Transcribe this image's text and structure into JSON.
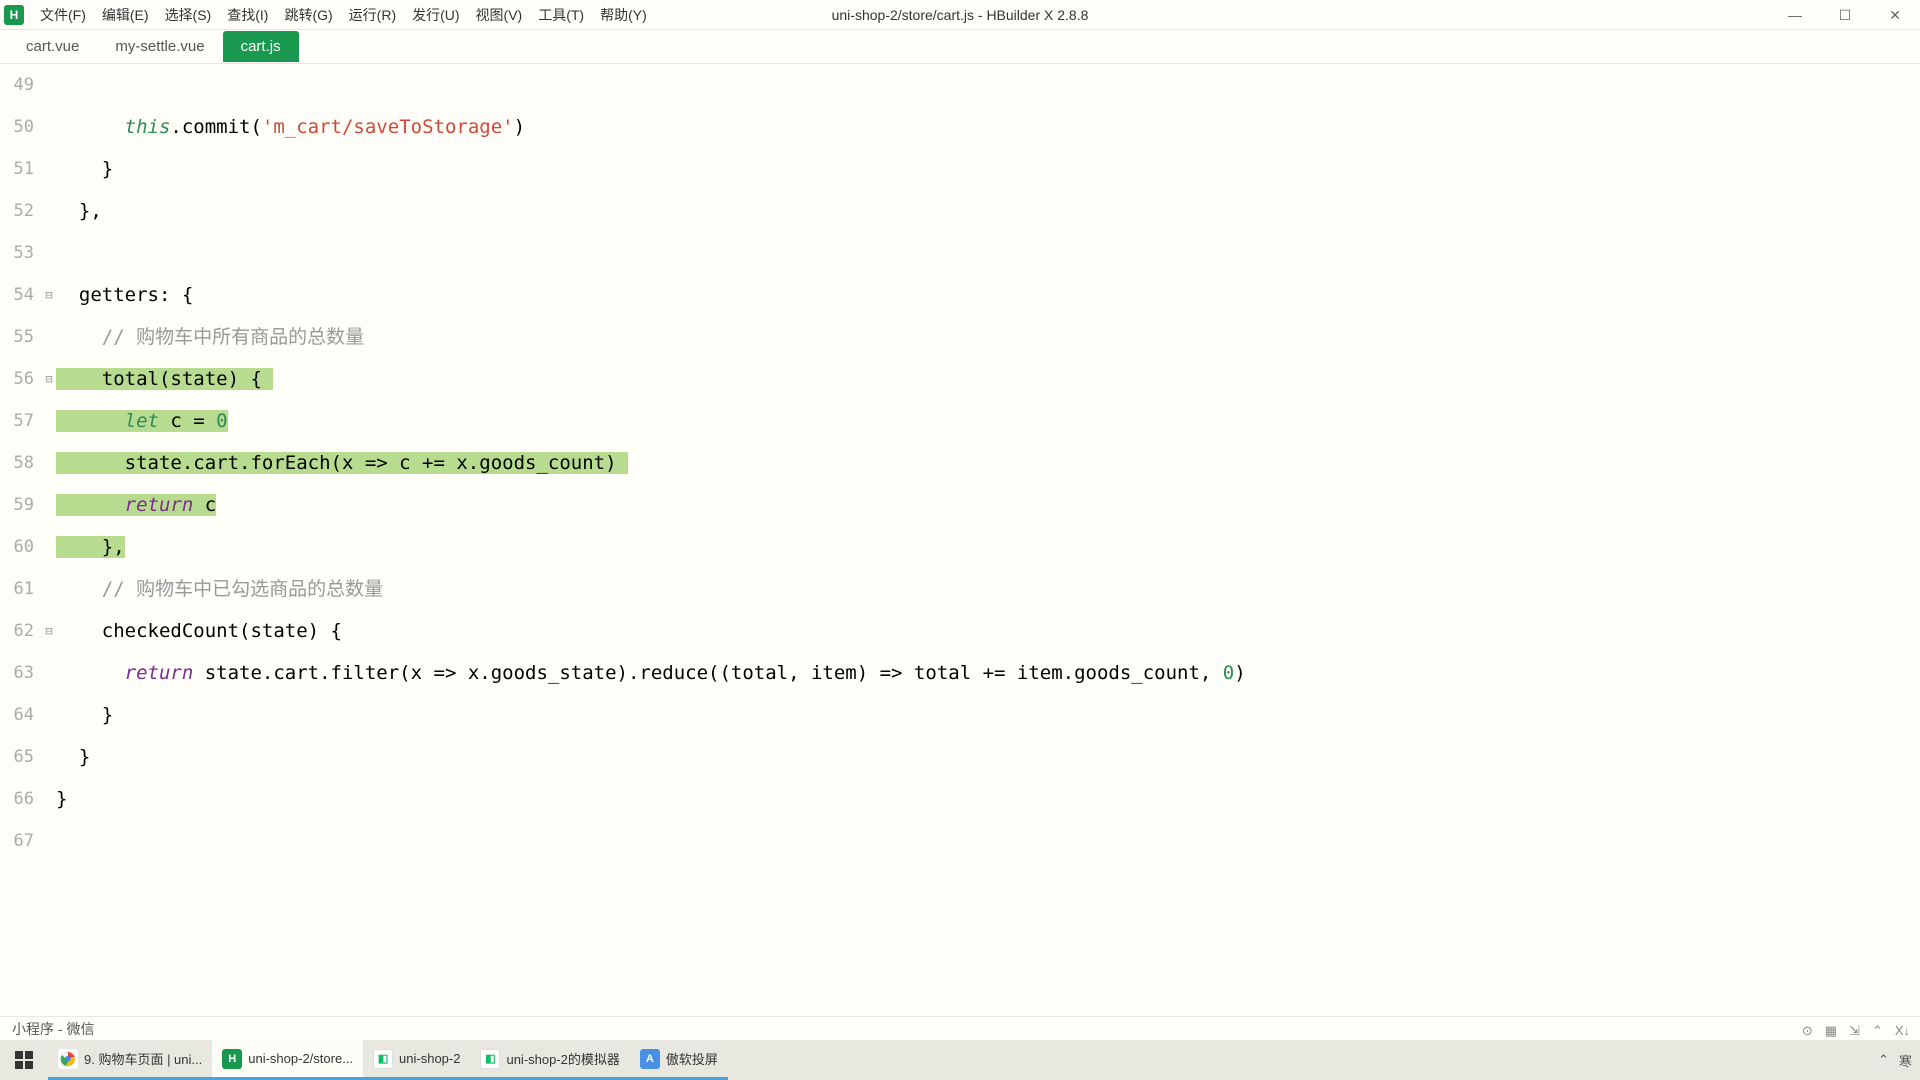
{
  "app": {
    "icon_letter": "H",
    "title": "uni-shop-2/store/cart.js - HBuilder X 2.8.8"
  },
  "menus": {
    "file": "文件(F)",
    "edit": "编辑(E)",
    "select": "选择(S)",
    "find": "查找(I)",
    "goto": "跳转(G)",
    "run": "运行(R)",
    "publish": "发行(U)",
    "view": "视图(V)",
    "tools": "工具(T)",
    "help": "帮助(Y)"
  },
  "win_ctrl": {
    "min": "—",
    "max": "☐",
    "close": "✕"
  },
  "tabs": {
    "t1": "cart.vue",
    "t2": "my-settle.vue",
    "t3": "cart.js"
  },
  "gutter": {
    "l49": "49",
    "l50": "50",
    "l51": "51",
    "l52": "52",
    "l53": "53",
    "l54": "54",
    "l55": "55",
    "l56": "56",
    "l57": "57",
    "l58": "58",
    "l59": "59",
    "l60": "60",
    "l61": "61",
    "l62": "62",
    "l63": "63",
    "l64": "64",
    "l65": "65",
    "l66": "66",
    "l67": "67"
  },
  "fold": {
    "f54": "⊟",
    "f56": "⊟",
    "f62": "⊟"
  },
  "code": {
    "l50_this": "this",
    "l50_rest": ".commit(",
    "l50_str": "'m_cart/saveToStorage'",
    "l50_end": ")",
    "l51": "}",
    "l52": "},",
    "l54_a": "getters: {",
    "l55_a": "// 购物车中所有商品的总数量",
    "l56_pre": "    ",
    "l56_a": "total(state) {",
    "l57_pre": "      ",
    "l57_let": "let",
    "l57_rest": " c = ",
    "l57_num": "0",
    "l58_pre": "      ",
    "l58_a": "state.cart.forEach(x => c += x.goods_count)",
    "l59_pre": "      ",
    "l59_ret": "return",
    "l59_rest": " c",
    "l60_pre": "    ",
    "l60_a": "},",
    "l61_a": "// 购物车中已勾选商品的总数量",
    "l62_a": "checkedCount(state) {",
    "l63_ret": "return",
    "l63_rest": " state.cart.filter(x => x.goods_state).reduce((total, item) => total += item.goods_count, ",
    "l63_num": "0",
    "l63_end": ")",
    "l64": "}",
    "l65": "}",
    "l66": "}"
  },
  "console": {
    "title": "小程序 - 微信",
    "i1": "⊙",
    "i2": "▦",
    "i3": "⇲",
    "i4": "⌃",
    "i5": "X↓"
  },
  "taskbar": {
    "chrome_label": "9. 购物车页面 | uni...",
    "hb_label": "uni-shop-2/store...",
    "wx_label": "uni-shop-2",
    "sim_label": "uni-shop-2的模拟器",
    "ao_label": "傲软投屏",
    "tray_up": "⌃",
    "tray_ime": "寒"
  }
}
